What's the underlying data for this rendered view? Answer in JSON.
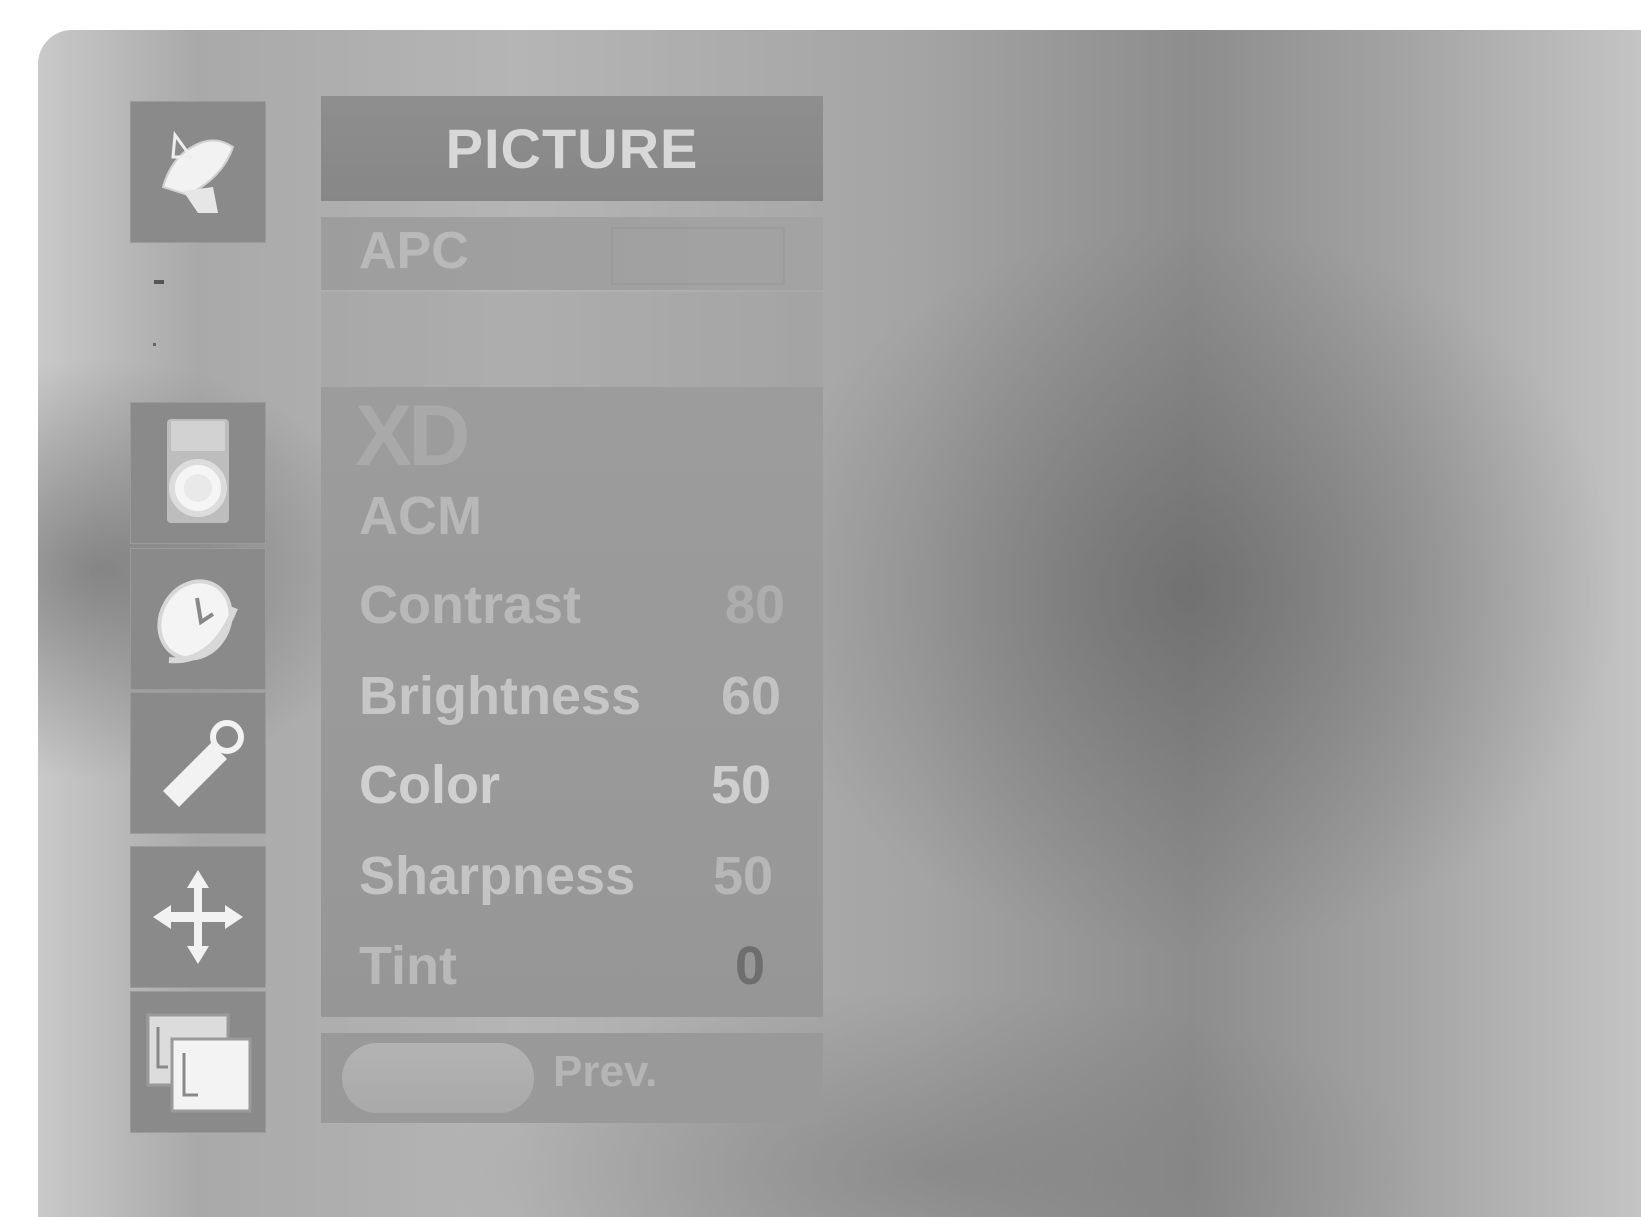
{
  "menu": {
    "title": "PICTURE",
    "apc_label": "APC",
    "xd_label": "XD",
    "acm_label": "ACM",
    "items": [
      {
        "label": "Contrast",
        "value": "80"
      },
      {
        "label": "Brightness",
        "value": "60"
      },
      {
        "label": "Color",
        "value": "50"
      },
      {
        "label": "Sharpness",
        "value": "50"
      },
      {
        "label": "Tint",
        "value": "0"
      }
    ],
    "footer_label": "Prev."
  },
  "side_icons": [
    "satellite-dish-icon",
    "speaker-icon",
    "clock-icon",
    "key-lock-icon",
    "move-arrows-icon",
    "windows-icon"
  ]
}
